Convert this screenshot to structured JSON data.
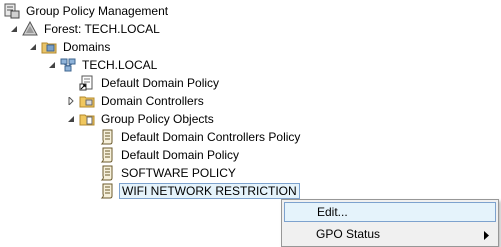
{
  "tree": {
    "root": "Group Policy Management",
    "forest": "Forest: TECH.LOCAL",
    "domains": "Domains",
    "domain": "TECH.LOCAL",
    "default_domain_policy": "Default Domain Policy",
    "domain_controllers": "Domain Controllers",
    "gpo_container": "Group Policy Objects",
    "gpos": [
      "Default Domain Controllers Policy",
      "Default Domain Policy",
      "SOFTWARE POLICY",
      "WIFI NETWORK RESTRICTION"
    ]
  },
  "context_menu": {
    "items": [
      "Edit...",
      "GPO Status"
    ]
  },
  "colors": {
    "selection_bg": "#e5f3fb",
    "selection_border": "#7da2ce",
    "menu_bg": "#f0f0f0"
  }
}
